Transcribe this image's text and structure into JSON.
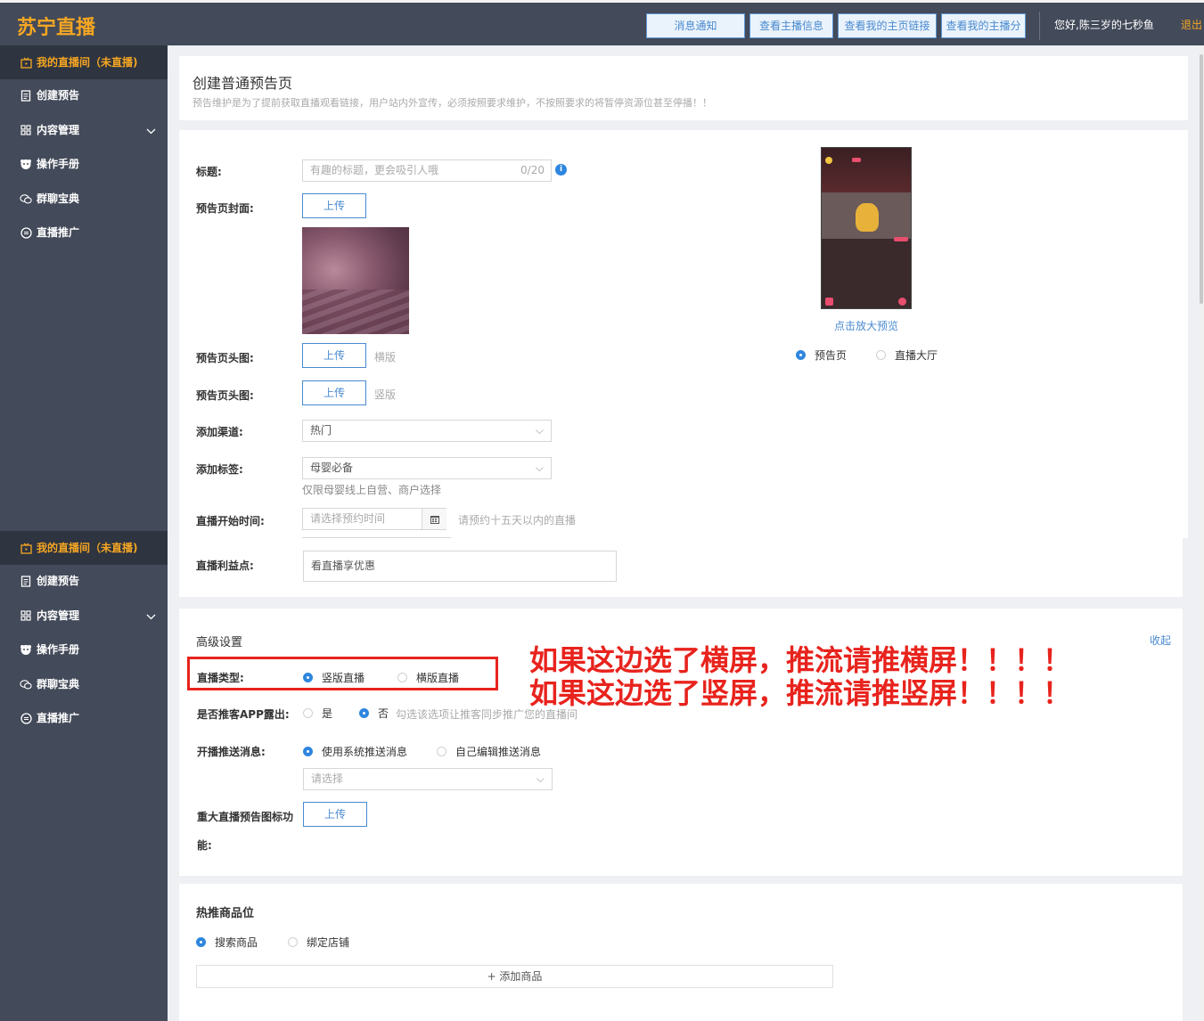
{
  "app": {
    "logo": "苏宁直播"
  },
  "header": {
    "buttons": [
      "消息通知",
      "查看主播信息",
      "查看我的主页链接",
      "查看我的主播分"
    ],
    "greeting": "您好,陈三岁的七秒鱼",
    "logout": "退出"
  },
  "sidebar": {
    "items": [
      {
        "label": "我的直播间（未直播)",
        "icon": "tv-icon",
        "active": true
      },
      {
        "label": "创建预告",
        "icon": "document-icon"
      },
      {
        "label": "内容管理",
        "icon": "grid-icon",
        "expandable": true
      },
      {
        "label": "操作手册",
        "icon": "manual-icon"
      },
      {
        "label": "群聊宝典",
        "icon": "chat-icon"
      },
      {
        "label": "直播推广",
        "icon": "promote-icon"
      }
    ]
  },
  "page": {
    "title": "创建普通预告页",
    "note": "预告维护是为了提前获取直播观看链接，用户站内外宣传，必须按照要求维护，不按照要求的将暂停资源位甚至停播！！"
  },
  "form": {
    "title_label": "标题:",
    "title_placeholder": "有趣的标题，更会吸引人哦",
    "title_count": "0/20",
    "cover_label": "预告页封面:",
    "upload": "上传",
    "head_h_label": "预告页头图:",
    "head_h_hint": "横版",
    "head_v_label": "预告页头图:",
    "head_v_hint": "竖版",
    "channel_label": "添加渠道:",
    "channel_value": "热门",
    "tag_label": "添加标签:",
    "tag_value": "母婴必备",
    "tag_hint": "仅限母婴线上自营、商户选择",
    "start_label": "直播开始时间:",
    "start_placeholder": "请选择预约时间",
    "start_hint": "请预约十五天以内的直播",
    "benefit_label": "直播利益点:",
    "benefit_value": "看直播享优惠"
  },
  "preview": {
    "zoom_link": "点击放大预览",
    "options": [
      "预告页",
      "直播大厅"
    ],
    "selected": "预告页"
  },
  "advanced": {
    "title": "高级设置",
    "collapse": "收起",
    "type_label": "直播类型:",
    "type_options": [
      "竖版直播",
      "横版直播"
    ],
    "type_selected": "竖版直播",
    "app_label": "是否推客APP露出:",
    "app_options": [
      "是",
      "否"
    ],
    "app_selected": "否",
    "app_hint": "勾选该选项让推客同步推广您的直播间",
    "push_label": "开播推送消息:",
    "push_options": [
      "使用系统推送消息",
      "自己编辑推送消息"
    ],
    "push_selected": "使用系统推送消息",
    "push_select_placeholder": "请选择",
    "major_label_1": "重大直播预告图标功",
    "major_label_2": "能:"
  },
  "hot": {
    "title": "热推商品位",
    "options": [
      "搜索商品",
      "绑定店铺"
    ],
    "selected": "搜索商品",
    "add": "+ 添加商品"
  },
  "annotation": {
    "line1": "如果这边选了横屏，推流请推横屏！！！！",
    "line2": "如果这边选了竖屏，推流请推竖屏！！！！"
  },
  "colors": {
    "header_bg": "#434a59",
    "accent": "#f5a623",
    "link": "#4a8ad0",
    "annotation": "#e8231d"
  }
}
